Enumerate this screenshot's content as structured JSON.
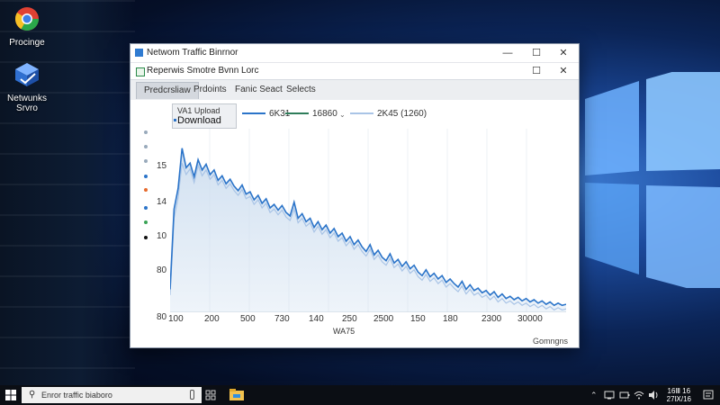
{
  "desktop": {
    "icons": [
      {
        "label": "Procinge",
        "icon": "chrome-icon"
      },
      {
        "label": "Netwunks Srvro",
        "icon": "network-server-icon"
      }
    ]
  },
  "window": {
    "title": "Netwom Traffic Binrnor",
    "inner_title": "Reperwis Smotre Bvnn Lorc",
    "tabs": [
      {
        "label": "Predcrsliaw",
        "active": true
      },
      {
        "label": "Prdoints"
      },
      {
        "label": "Fanic Seact"
      },
      {
        "label": "Selects"
      }
    ],
    "controls": {
      "minimize": "—",
      "maximize": "☐",
      "close": "✕"
    }
  },
  "legend": {
    "upload_label": "VA1 Upload",
    "download_label": "Download",
    "series": [
      {
        "label": "6K31",
        "color": "#2b74c9"
      },
      {
        "label": "16860",
        "color": "#2e7d5a"
      },
      {
        "label": "2K45 (1260)",
        "color": "#a9c4e6"
      }
    ]
  },
  "status_text": "Gomngns",
  "colors": {
    "accent": "#2b74c9",
    "fill": "#cfdff0",
    "secondary": "#2e7d5a"
  },
  "taskbar": {
    "search_text": "Enror traffic biaboro",
    "clock_time": "16Ⅲ 16",
    "clock_date": "27Ⅸ/16"
  },
  "chart_data": {
    "type": "area",
    "title": "",
    "xlabel": "WA75",
    "ylabel": "",
    "y_ticks": [
      "15",
      "14",
      "10",
      "80",
      "80"
    ],
    "x_ticks": [
      "100",
      "200",
      "500",
      "730",
      "140",
      "250",
      "2500",
      "150",
      "180",
      "2300",
      "30000"
    ],
    "series": [
      {
        "name": "Download",
        "values": [
          2,
          9,
          10.8,
          14.3,
          12.6,
          13.0,
          11.8,
          13.3,
          12.4,
          12.9,
          12.0,
          12.4,
          11.5,
          11.9,
          11.2,
          11.6,
          11.0,
          10.6,
          11.1,
          10.3,
          10.5,
          9.8,
          10.2,
          9.5,
          9.9,
          9.1,
          9.4,
          8.9,
          9.3,
          8.7,
          8.4,
          9.6,
          8.2,
          8.6,
          7.9,
          8.2,
          7.4,
          7.9,
          7.2,
          7.6,
          6.9,
          7.3,
          6.6,
          6.9,
          6.2,
          6.6,
          5.9,
          6.3,
          5.7,
          5.3,
          5.9,
          5.0,
          5.4,
          4.8,
          4.5,
          5.1,
          4.3,
          4.6,
          4.0,
          4.4,
          3.8,
          4.1,
          3.5,
          3.2,
          3.7,
          3.1,
          3.4,
          2.9,
          3.2,
          2.6,
          2.9,
          2.5,
          2.2,
          2.7,
          2.0,
          2.4,
          1.9,
          2.1,
          1.7,
          1.9,
          1.5,
          1.8,
          1.3,
          1.6,
          1.2,
          1.4,
          1.1,
          1.3,
          1.0,
          1.2,
          0.9,
          1.1,
          0.8,
          1.0,
          0.7,
          0.9,
          0.6,
          0.8,
          0.6,
          0.7
        ]
      },
      {
        "name": "Upload",
        "values": [
          1.5,
          8.2,
          10.0,
          13.0,
          12.0,
          12.5,
          11.3,
          12.8,
          11.9,
          12.4,
          11.6,
          12.0,
          11.1,
          11.5,
          10.8,
          11.2,
          10.6,
          10.2,
          10.7,
          9.9,
          10.1,
          9.4,
          9.8,
          9.1,
          9.5,
          8.7,
          9.0,
          8.5,
          8.9,
          8.3,
          8.0,
          9.0,
          7.8,
          8.2,
          7.5,
          7.8,
          7.0,
          7.5,
          6.8,
          7.2,
          6.5,
          6.9,
          6.2,
          6.5,
          5.8,
          6.2,
          5.5,
          5.9,
          5.3,
          4.9,
          5.5,
          4.6,
          5.0,
          4.4,
          4.1,
          4.7,
          3.9,
          4.2,
          3.6,
          4.0,
          3.4,
          3.7,
          3.1,
          2.8,
          3.3,
          2.7,
          3.0,
          2.5,
          2.8,
          2.2,
          2.5,
          2.1,
          1.8,
          2.3,
          1.6,
          2.0,
          1.5,
          1.7,
          1.3,
          1.5,
          1.1,
          1.4,
          0.9,
          1.2,
          0.8,
          1.0,
          0.7,
          0.9,
          0.6,
          0.8,
          0.5,
          0.7,
          0.4,
          0.6,
          0.3,
          0.5,
          0.2,
          0.4,
          0.2,
          0.3
        ]
      }
    ],
    "ylim": [
      0,
      16
    ],
    "grid": true
  }
}
